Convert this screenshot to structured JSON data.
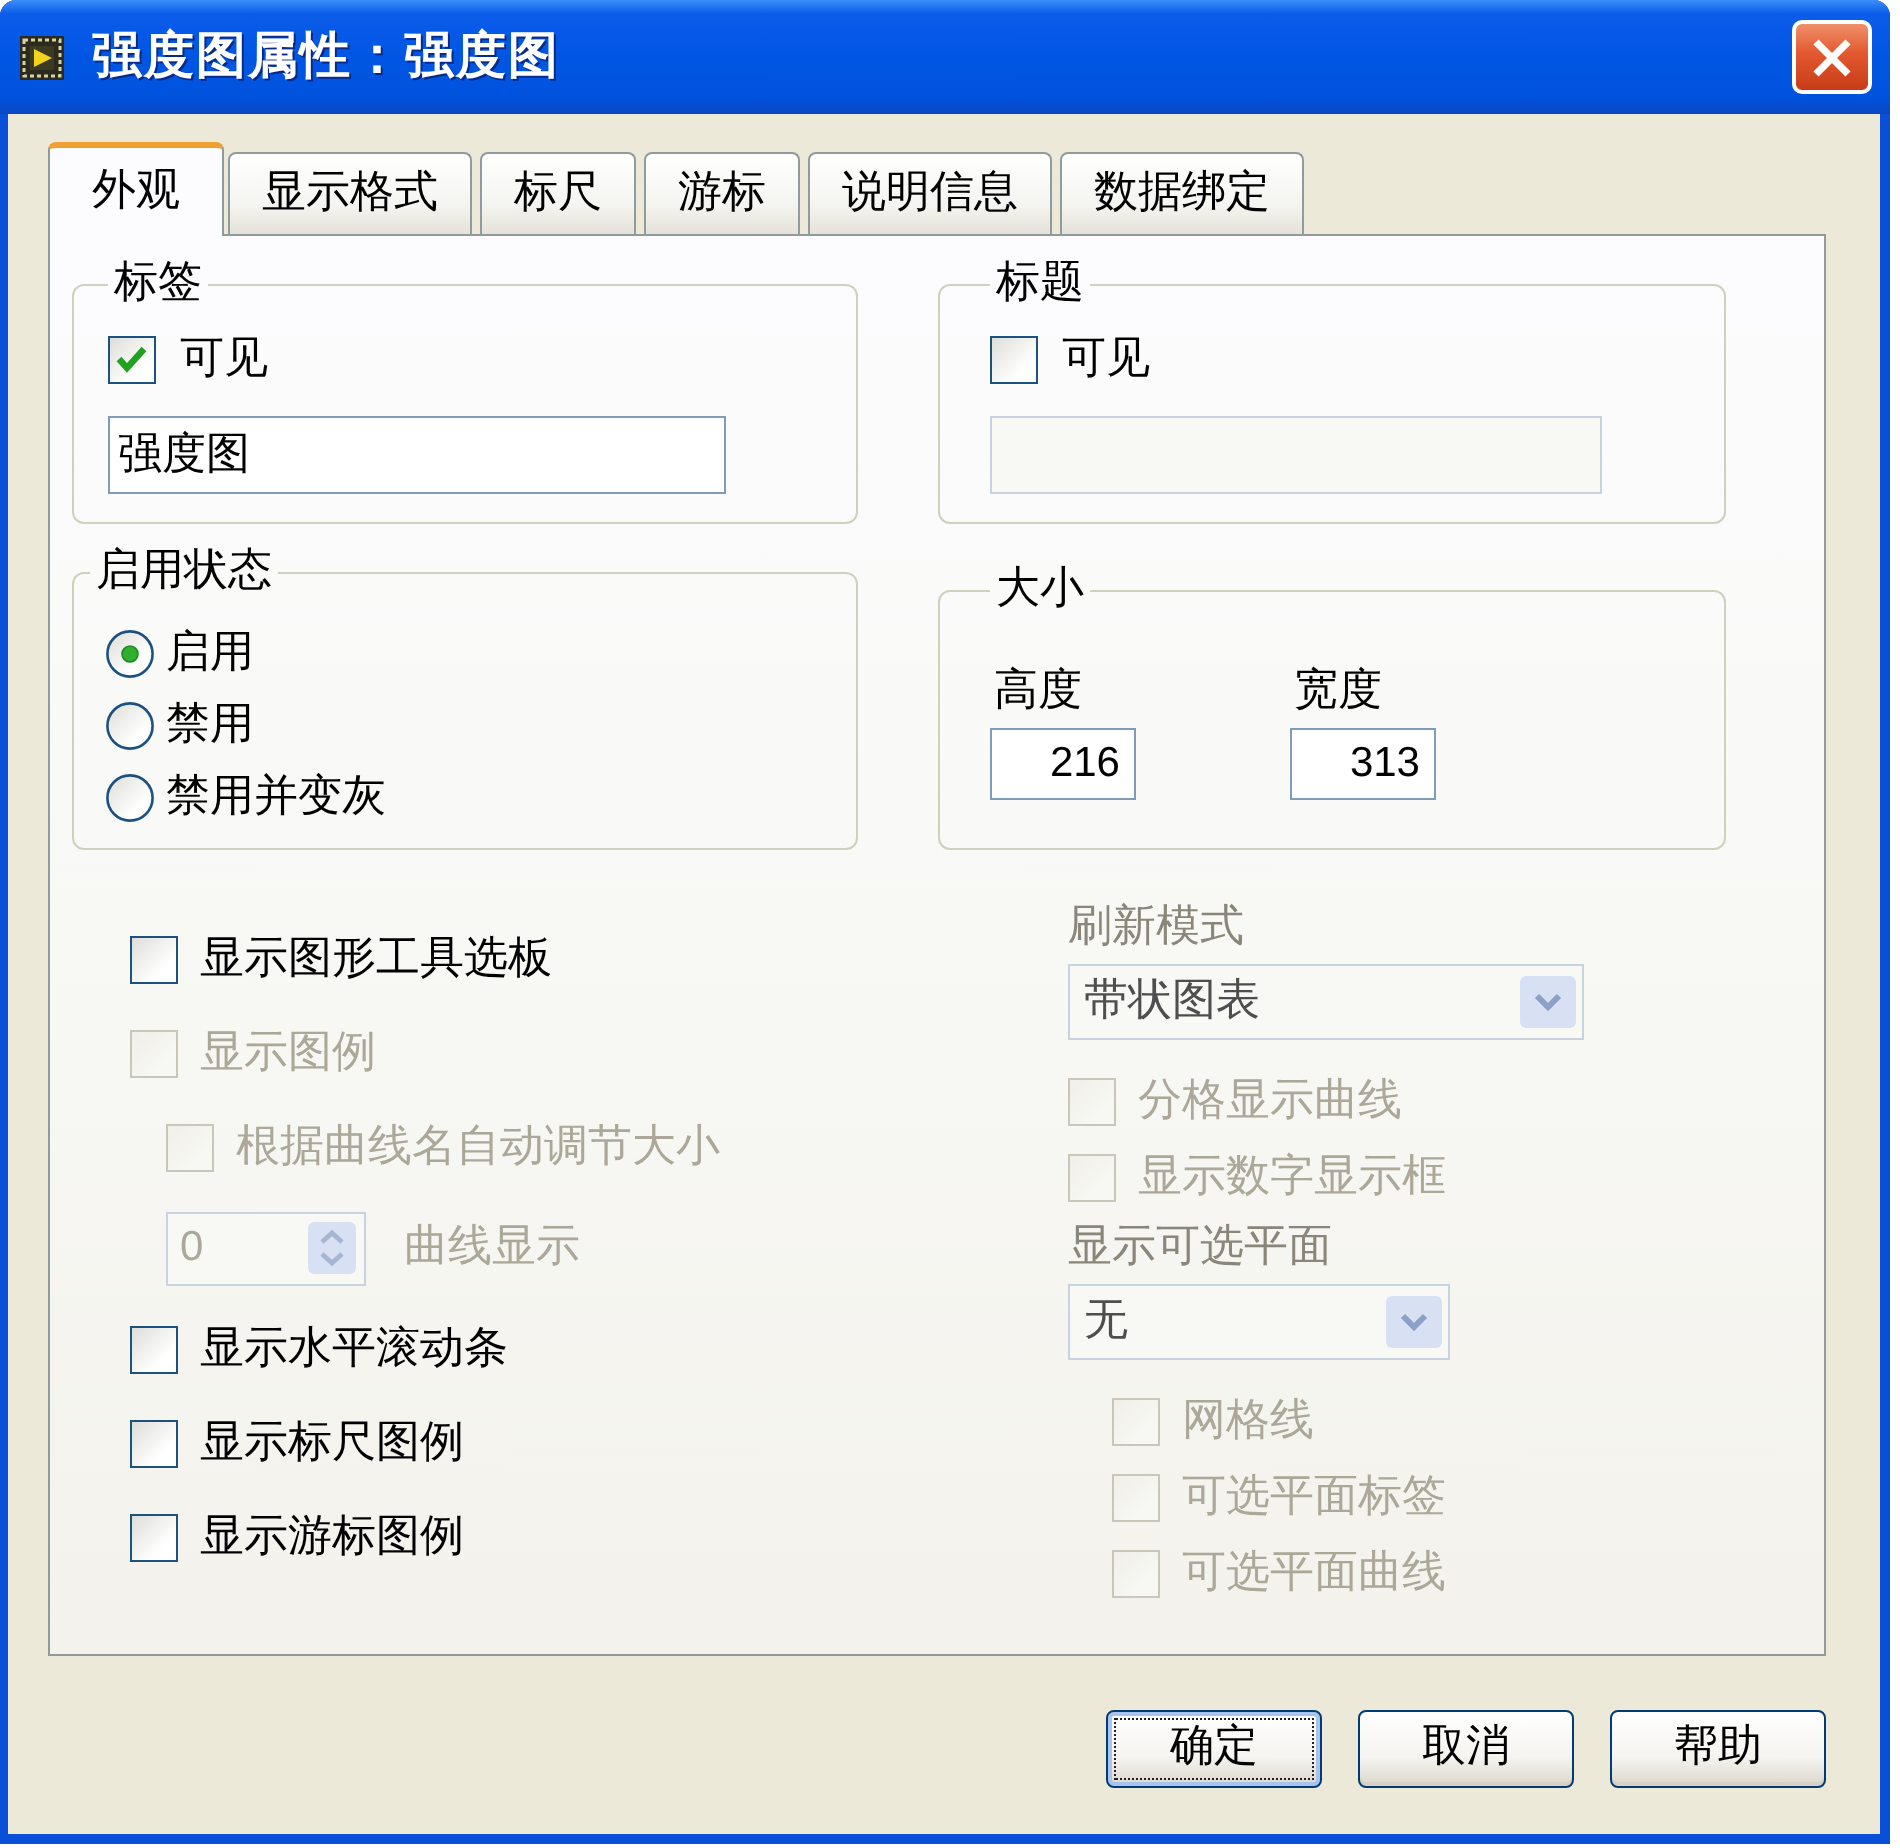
{
  "window": {
    "title": "强度图属性：强度图"
  },
  "tabs": [
    {
      "label": "外观",
      "selected": true
    },
    {
      "label": "显示格式",
      "selected": false
    },
    {
      "label": "标尺",
      "selected": false
    },
    {
      "label": "游标",
      "selected": false
    },
    {
      "label": "说明信息",
      "selected": false
    },
    {
      "label": "数据绑定",
      "selected": false
    }
  ],
  "label_group": {
    "legend": "标签",
    "visible": {
      "label": "可见",
      "checked": true
    },
    "field": {
      "value": "强度图",
      "disabled": false
    }
  },
  "caption_group": {
    "legend": "标题",
    "visible": {
      "label": "可见",
      "checked": false
    },
    "field": {
      "disabled": true
    }
  },
  "enable_state": {
    "legend": "启用状态",
    "options": [
      {
        "label": "启用",
        "selected": true
      },
      {
        "label": "禁用",
        "selected": false
      },
      {
        "label": "禁用并变灰",
        "selected": false
      }
    ]
  },
  "size_group": {
    "legend": "大小",
    "fields": [
      {
        "label": "高度",
        "value": "216"
      },
      {
        "label": "宽度",
        "value": "313"
      }
    ]
  },
  "left_options": [
    {
      "kind": "checkbox",
      "label": "显示图形工具选板",
      "checked": false,
      "disabled": false
    },
    {
      "kind": "checkbox",
      "label": "显示图例",
      "checked": false,
      "disabled": true,
      "children": [
        {
          "kind": "checkbox",
          "label": "根据曲线名自动调节大小",
          "checked": false,
          "disabled": true
        },
        {
          "kind": "numeric",
          "value": "0",
          "caption": "曲线显示",
          "disabled": true
        }
      ]
    },
    {
      "kind": "checkbox",
      "label": "显示水平滚动条",
      "checked": false,
      "disabled": false
    },
    {
      "kind": "checkbox",
      "label": "显示标尺图例",
      "checked": false,
      "disabled": false
    },
    {
      "kind": "checkbox",
      "label": "显示游标图例",
      "checked": false,
      "disabled": false
    }
  ],
  "right_options": [
    {
      "kind": "dropdown",
      "label": "刷新模式",
      "value": "带状图表",
      "disabled": true
    },
    {
      "kind": "checkbox",
      "label": "分格显示曲线",
      "checked": false,
      "disabled": true
    },
    {
      "kind": "checkbox",
      "label": "显示数字显示框",
      "checked": false,
      "disabled": true
    },
    {
      "kind": "dropdown",
      "label": "显示可选平面",
      "value": "无",
      "disabled": true,
      "children": [
        {
          "kind": "checkbox",
          "label": "网格线",
          "checked": false,
          "disabled": true
        },
        {
          "kind": "checkbox",
          "label": "可选平面标签",
          "checked": false,
          "disabled": true
        },
        {
          "kind": "checkbox",
          "label": "可选平面曲线",
          "checked": false,
          "disabled": true
        }
      ]
    }
  ],
  "buttons": [
    {
      "label": "确定",
      "default": true
    },
    {
      "label": "取消",
      "default": false
    },
    {
      "label": "帮助",
      "default": false
    }
  ]
}
